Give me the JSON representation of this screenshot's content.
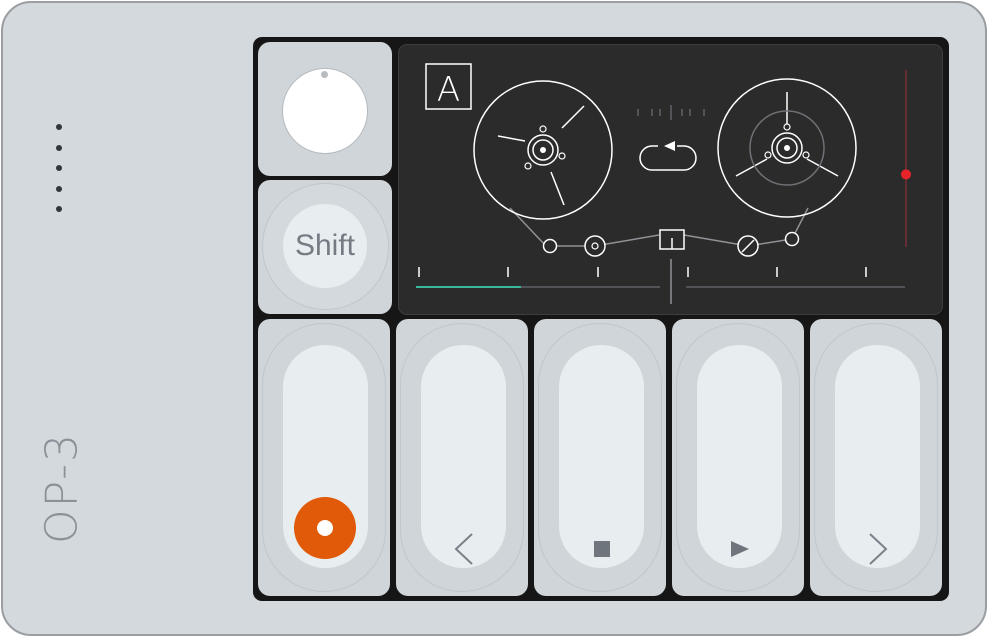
{
  "device": {
    "brand": "OP-3",
    "colors": {
      "body": "#d3d9dc",
      "key": "#cfd5d8",
      "key_face": "#e8edef",
      "screen": "#2b2b2b",
      "record": "#e05a0a",
      "playhead": "#e8232a",
      "progress": "#39b89c"
    }
  },
  "controls": {
    "knob": {
      "icon": "knob-dial"
    },
    "shift": {
      "label": "Shift"
    },
    "transport": [
      {
        "id": "record",
        "icon": "record-icon"
      },
      {
        "id": "previous",
        "icon": "chevron-left-icon"
      },
      {
        "id": "stop",
        "icon": "stop-icon"
      },
      {
        "id": "play",
        "icon": "play-icon"
      },
      {
        "id": "next",
        "icon": "chevron-right-icon"
      }
    ]
  },
  "screen": {
    "track_label": "A",
    "loop_icon": "loop-icon",
    "progress_fraction": 0.43,
    "level_fraction": 0.41
  }
}
